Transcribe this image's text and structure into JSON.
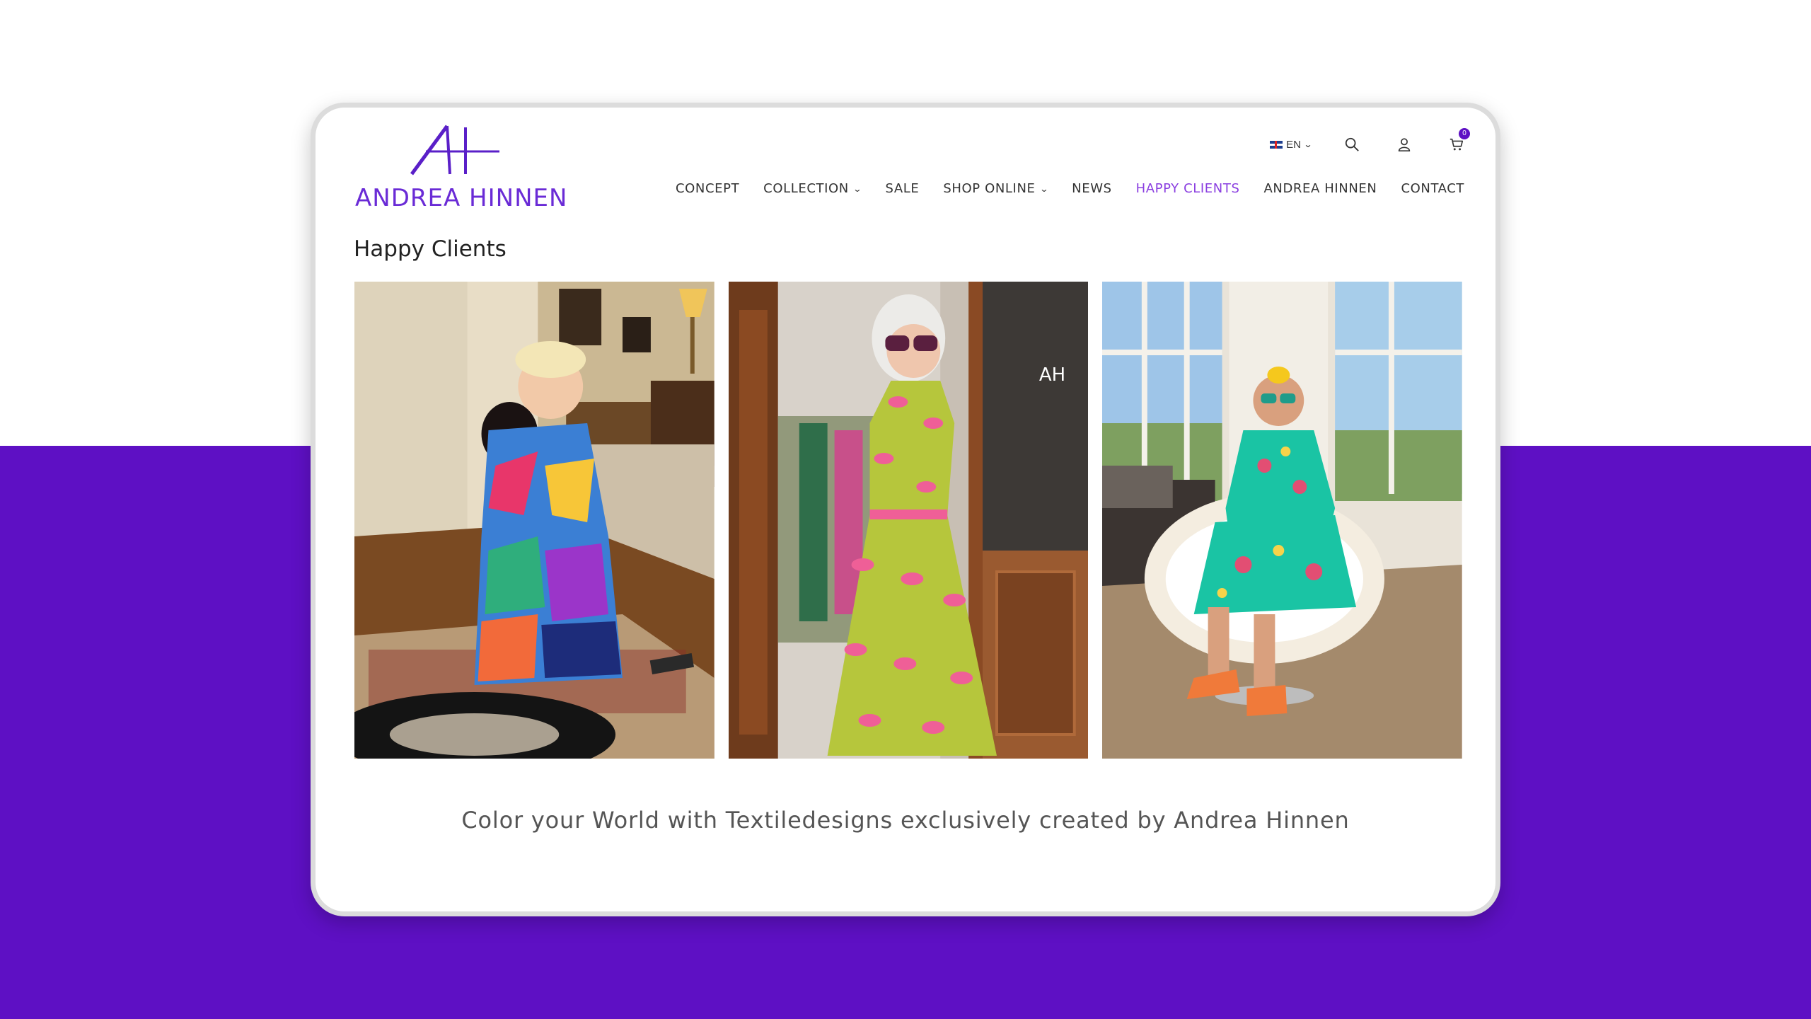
{
  "brand": {
    "name": "ANDREA HINNEN",
    "primary_color": "#5e10c4",
    "accent_color": "#8a3ee0"
  },
  "utility": {
    "language": "EN",
    "cart_count": "0",
    "icons": [
      "flag-uk-icon",
      "chevron-down-icon",
      "search-icon",
      "user-icon",
      "cart-icon"
    ]
  },
  "nav": {
    "items": [
      {
        "label": "CONCEPT",
        "has_dropdown": false
      },
      {
        "label": "COLLECTION",
        "has_dropdown": true
      },
      {
        "label": "SALE",
        "has_dropdown": false
      },
      {
        "label": "SHOP ONLINE",
        "has_dropdown": true
      },
      {
        "label": "NEWS",
        "has_dropdown": false
      },
      {
        "label": "HAPPY CLIENTS",
        "has_dropdown": false,
        "active": true
      },
      {
        "label": "ANDREA HINNEN",
        "has_dropdown": false
      },
      {
        "label": "CONTACT",
        "has_dropdown": false
      }
    ]
  },
  "page": {
    "title": "Happy Clients",
    "tagline": "Color your World with Textiledesigns exclusively created by Andrea Hinnen"
  },
  "photos": [
    {
      "name": "client-photo-1"
    },
    {
      "name": "client-photo-2"
    },
    {
      "name": "client-photo-3"
    }
  ]
}
